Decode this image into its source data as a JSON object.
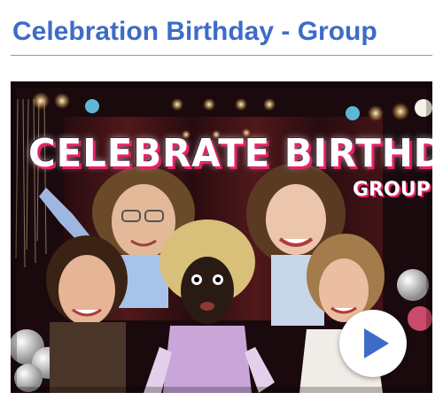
{
  "page": {
    "title": "Celebration Birthday - Group"
  },
  "video": {
    "overlay_title": "CELEBRATE BIRTHDAY",
    "overlay_subtitle": "GROUP",
    "play_icon": "play-icon"
  },
  "colors": {
    "title": "#3d6cc6",
    "accent_pink": "#e8206a",
    "play_icon": "#3d6cc6",
    "rule": "#9a9a9a"
  }
}
